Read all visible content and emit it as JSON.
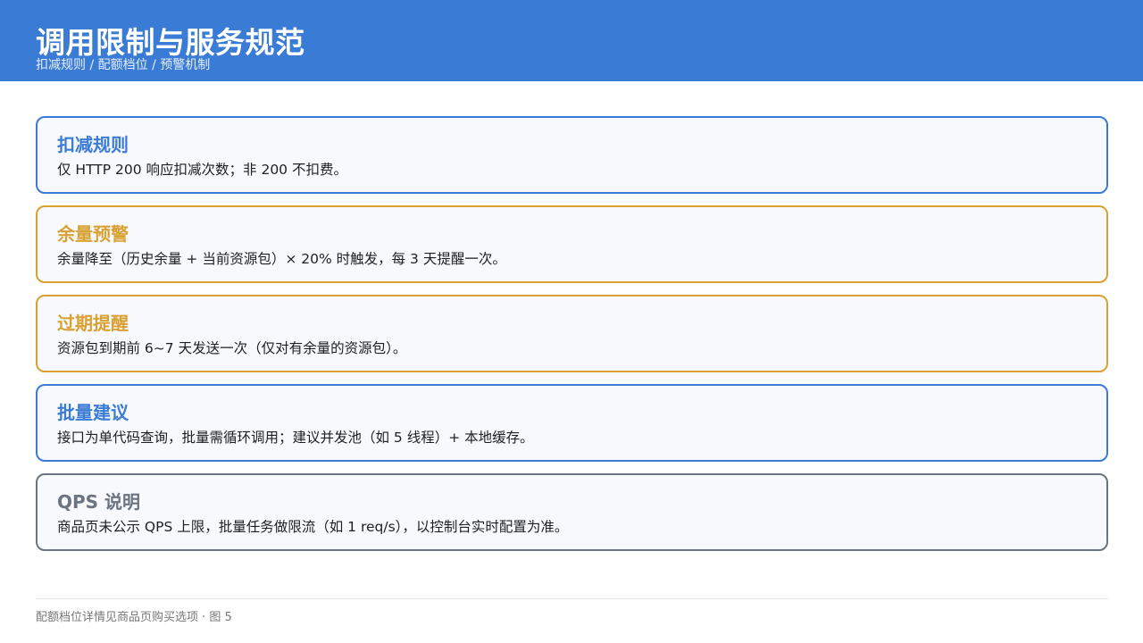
{
  "header": {
    "title": "调用限制与服务规范",
    "subtitle": "扣减规则 / 配额档位 / 预警机制"
  },
  "colors": {
    "header_bg": "#3a7bd5",
    "blue": "#3a7bd5",
    "amber": "#d9a133",
    "gray": "#6b7480"
  },
  "cards": [
    {
      "title": "扣减规则",
      "text": "仅 HTTP 200 响应扣减次数；非 200 不扣费。",
      "accent": "#3a7bd5"
    },
    {
      "title": "余量预警",
      "text": "余量降至（历史余量 + 当前资源包）× 20% 时触发，每 3 天提醒一次。",
      "accent": "#d9a133"
    },
    {
      "title": "过期提醒",
      "text": "资源包到期前 6~7 天发送一次（仅对有余量的资源包）。",
      "accent": "#d9a133"
    },
    {
      "title": "批量建议",
      "text": "接口为单代码查询，批量需循环调用；建议并发池（如 5 线程）+ 本地缓存。",
      "accent": "#3a7bd5"
    },
    {
      "title": "QPS 说明",
      "text": "商品页未公示 QPS 上限，批量任务做限流（如 1 req/s），以控制台实时配置为准。",
      "accent": "#6b7480"
    }
  ],
  "footer": {
    "note": "配额档位详情见商品页购买选项 · 图 5"
  }
}
